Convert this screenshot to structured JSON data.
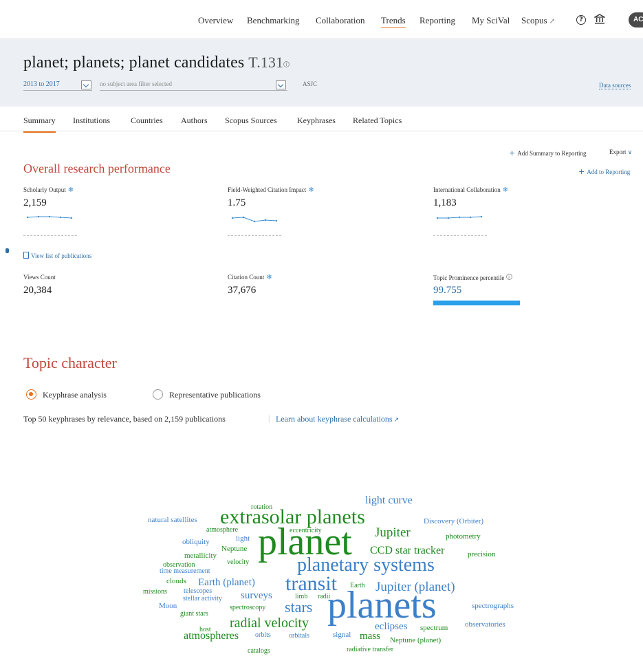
{
  "nav": {
    "items": [
      "Overview",
      "Benchmarking",
      "Collaboration",
      "Trends",
      "Reporting",
      "My SciVal",
      "Scopus"
    ],
    "active": "Trends",
    "avatar": "AC",
    "help_icon": "?"
  },
  "header": {
    "title": "planet; planets; planet candidates",
    "topic_code": "T.131",
    "info_icon": "i",
    "year_range": "2013 to 2017",
    "subject_filter": "no subject area filter selected",
    "classification": "ASJC",
    "data_sources": "Data sources"
  },
  "tabs": [
    "Summary",
    "Institutions",
    "Countries",
    "Authors",
    "Scopus Sources",
    "Keyphrases",
    "Related Topics"
  ],
  "actions": {
    "add_summary": "Add Summary to Reporting",
    "export": "Export",
    "add_reporting": "Add to Reporting"
  },
  "performance": {
    "title": "Overall research performance",
    "view_list": "View list of publications",
    "metrics": [
      {
        "label": "Scholarly Output",
        "value": "2,159"
      },
      {
        "label": "Field-Weighted Citation Impact",
        "value": "1.75"
      },
      {
        "label": "International Collaboration",
        "value": "1,183"
      },
      {
        "label": "Views Count",
        "value": "20,384"
      },
      {
        "label": "Citation Count",
        "value": "37,676"
      },
      {
        "label": "Topic Prominence percentile",
        "value": "99.755"
      }
    ],
    "prominence_fraction": 0.99755
  },
  "topic_character": {
    "title": "Topic character",
    "options": [
      "Keyphrase analysis",
      "Representative publications"
    ],
    "selected": "Keyphrase analysis",
    "note": "Top 50 keyphrases by relevance, based on 2,159 publications",
    "separator": "|",
    "link": "Learn about keyphrase calculations"
  },
  "colors": {
    "accent": "#e9711c",
    "section_title": "#c0483a",
    "link": "#2e6fa8",
    "cloud_green": "#1f8a1f",
    "cloud_blue": "#3d80c8",
    "bar": "#2a9fea"
  },
  "keyphrases": [
    {
      "text": "light curve",
      "color": "blue"
    },
    {
      "text": "rotation",
      "color": "green"
    },
    {
      "text": "natural satellites",
      "color": "blue"
    },
    {
      "text": "extrasolar planets",
      "color": "green"
    },
    {
      "text": "Discovery (Orbiter)",
      "color": "blue"
    },
    {
      "text": "atmosphere",
      "color": "green"
    },
    {
      "text": "eccentricity",
      "color": "green"
    },
    {
      "text": "Jupiter",
      "color": "green"
    },
    {
      "text": "photometry",
      "color": "green"
    },
    {
      "text": "obliquity",
      "color": "blue"
    },
    {
      "text": "light",
      "color": "blue"
    },
    {
      "text": "Neptune",
      "color": "green"
    },
    {
      "text": "planet",
      "color": "green"
    },
    {
      "text": "CCD star tracker",
      "color": "green"
    },
    {
      "text": "precision",
      "color": "green"
    },
    {
      "text": "metallicity",
      "color": "green"
    },
    {
      "text": "velocity",
      "color": "green"
    },
    {
      "text": "observation",
      "color": "green"
    },
    {
      "text": "time measurement",
      "color": "blue"
    },
    {
      "text": "planetary systems",
      "color": "blue"
    },
    {
      "text": "clouds",
      "color": "green"
    },
    {
      "text": "Earth (planet)",
      "color": "blue"
    },
    {
      "text": "transit",
      "color": "blue"
    },
    {
      "text": "Earth",
      "color": "green"
    },
    {
      "text": "Jupiter (planet)",
      "color": "blue"
    },
    {
      "text": "missions",
      "color": "green"
    },
    {
      "text": "telescopes",
      "color": "blue"
    },
    {
      "text": "surveys",
      "color": "blue"
    },
    {
      "text": "limb",
      "color": "green"
    },
    {
      "text": "radii",
      "color": "green"
    },
    {
      "text": "stellar activity",
      "color": "blue"
    },
    {
      "text": "Moon",
      "color": "blue"
    },
    {
      "text": "spectroscopy",
      "color": "green"
    },
    {
      "text": "stars",
      "color": "blue"
    },
    {
      "text": "planets",
      "color": "blue"
    },
    {
      "text": "spectrographs",
      "color": "blue"
    },
    {
      "text": "giant stars",
      "color": "green"
    },
    {
      "text": "radial velocity",
      "color": "green"
    },
    {
      "text": "eclipses",
      "color": "blue"
    },
    {
      "text": "spectrum",
      "color": "green"
    },
    {
      "text": "observatories",
      "color": "blue"
    },
    {
      "text": "host",
      "color": "green"
    },
    {
      "text": "atmospheres",
      "color": "green"
    },
    {
      "text": "orbits",
      "color": "blue"
    },
    {
      "text": "orbitals",
      "color": "blue"
    },
    {
      "text": "signal",
      "color": "blue"
    },
    {
      "text": "mass",
      "color": "green"
    },
    {
      "text": "Neptune (planet)",
      "color": "green"
    },
    {
      "text": "radiative transfer",
      "color": "green"
    },
    {
      "text": "catalogs",
      "color": "green"
    }
  ]
}
